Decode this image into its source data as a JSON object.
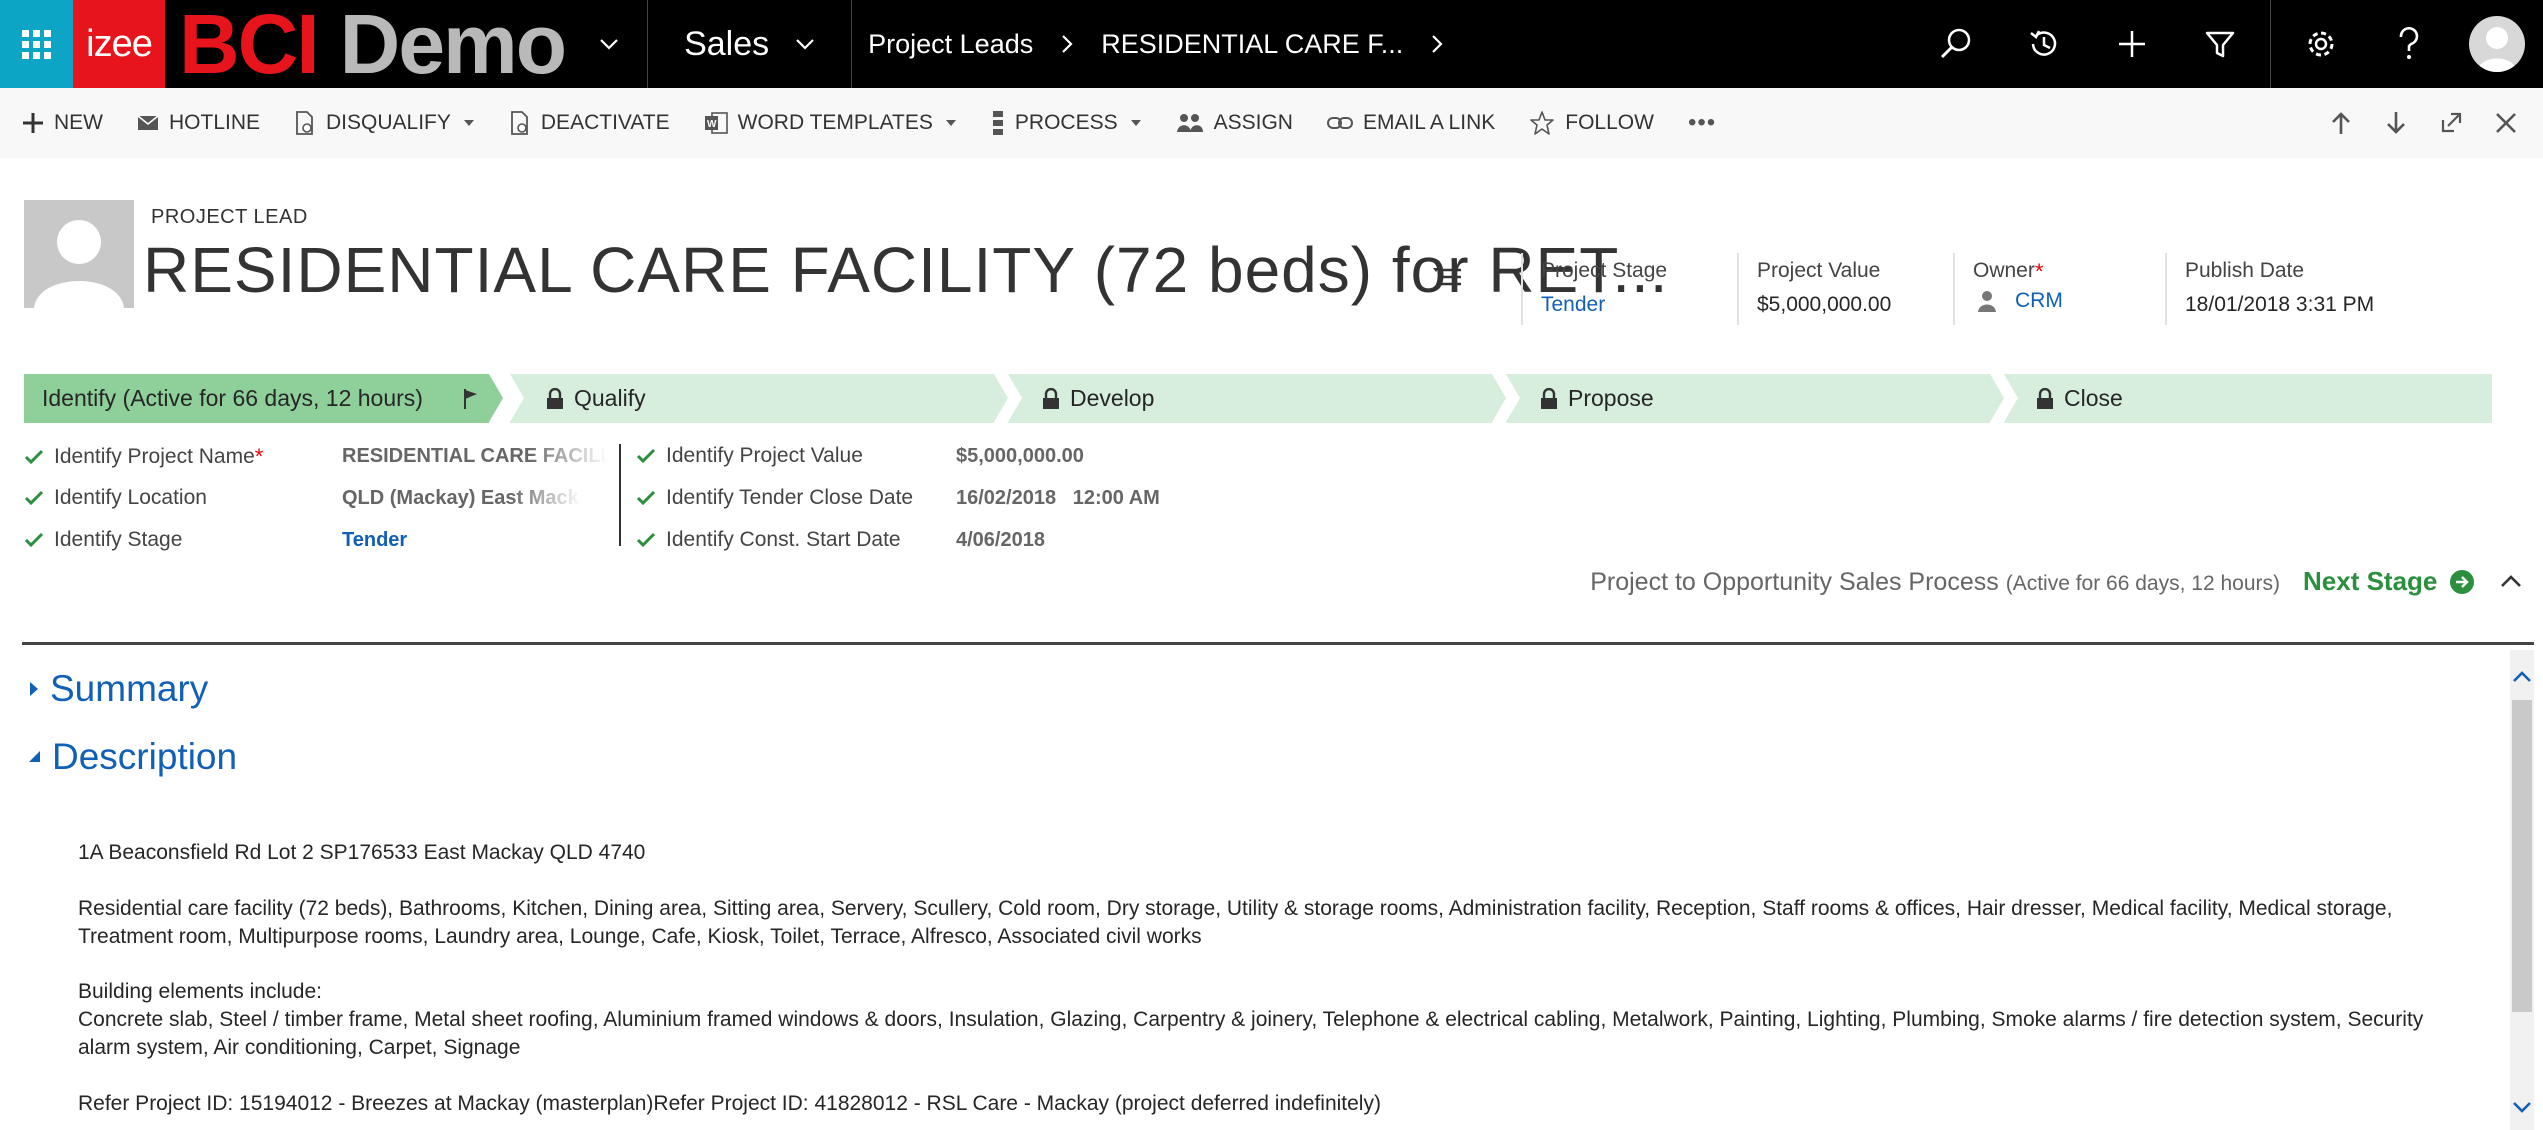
{
  "topnav": {
    "logo_izee": "izee",
    "logo_bci": "BCI",
    "logo_demo": "Demo",
    "area": "Sales",
    "breadcrumb": [
      "Project Leads",
      "RESIDENTIAL CARE F..."
    ]
  },
  "commands": {
    "new": "NEW",
    "hotline": "HOTLINE",
    "disqualify": "DISQUALIFY",
    "deactivate": "DEACTIVATE",
    "word_templates": "WORD TEMPLATES",
    "process": "PROCESS",
    "assign": "ASSIGN",
    "email_link": "EMAIL A LINK",
    "follow": "FOLLOW",
    "more": "•••"
  },
  "header": {
    "entity": "PROJECT LEAD",
    "title": "RESIDENTIAL CARE FACILITY (72 beds) for RET...",
    "fields": {
      "stage_label": "Project Stage",
      "stage_value": "Tender",
      "value_label": "Project Value",
      "value_value": "$5,000,000.00",
      "owner_label": "Owner",
      "owner_required": "*",
      "owner_value": "CRM",
      "publish_label": "Publish Date",
      "publish_value": "18/01/2018   3:31 PM"
    }
  },
  "process": {
    "stages": [
      "Identify (Active for 66 days, 12 hours)",
      "Qualify",
      "Develop",
      "Propose",
      "Close"
    ],
    "fields_left": [
      {
        "label": "Identify Project Name",
        "required": "*",
        "value": "RESIDENTIAL CARE FACILITY"
      },
      {
        "label": "Identify Location",
        "value": "QLD (Mackay) East Mackay"
      },
      {
        "label": "Identify Stage",
        "value": "Tender"
      }
    ],
    "fields_right": [
      {
        "label": "Identify Project Value",
        "value": "$5,000,000.00"
      },
      {
        "label": "Identify Tender Close Date",
        "value": "16/02/2018   12:00 AM"
      },
      {
        "label": "Identify Const. Start Date",
        "value": "4/06/2018"
      }
    ],
    "name": "Project to Opportunity Sales Process",
    "active": "(Active for 66 days, 12 hours)",
    "next_stage": "Next Stage"
  },
  "sections": {
    "summary": "Summary",
    "description": "Description"
  },
  "description": {
    "address": "1A Beaconsfield Rd Lot 2 SP176533 East Mackay QLD 4740",
    "facility": "Residential care facility (72 beds), Bathrooms, Kitchen, Dining area, Sitting area, Servery, Scullery, Cold room, Dry storage, Utility & storage rooms, Administration facility, Reception, Staff rooms & offices, Hair dresser, Medical facility, Medical storage, Treatment room, Multipurpose rooms, Laundry area, Lounge, Cafe, Kiosk, Toilet, Terrace, Alfresco, Associated civil works",
    "elements_heading": "Building elements include:",
    "elements": "Concrete slab, Steel / timber frame, Metal sheet roofing, Aluminium framed windows & doors, Insulation, Glazing, Carpentry & joinery, Telephone & electrical cabling, Metalwork, Painting, Lighting, Plumbing, Smoke alarms / fire detection system, Security alarm system, Air conditioning, Carpet, Signage",
    "refer": "Refer Project ID: 15194012 - Breezes at Mackay (masterplan)Refer Project ID: 41828012 - RSL Care - Mackay (project deferred indefinitely)"
  }
}
